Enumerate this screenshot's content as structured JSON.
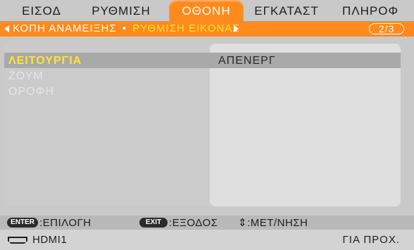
{
  "tabs": [
    {
      "label": "ΕΙΣΟΔ"
    },
    {
      "label": "ΡΥΘΜΙΣΗ"
    },
    {
      "label": "ΟΘΟΝΗ"
    },
    {
      "label": "ΕΓΚΑΤΑΣΤ"
    },
    {
      "label": "ΠΛΗΡΟΦ"
    }
  ],
  "active_tab": "ΟΘΟΝΗ",
  "subbar": {
    "previous": "ΚΟΠΗ ΑΝΑΜΕΙΞΗΣ",
    "separator": "•",
    "current": "ΡΥΘΜΙΣΗ ΕΙΚΟΝΑΣ",
    "page": "2/3"
  },
  "menu": {
    "items": [
      {
        "label": "ΛΕΙΤΟΥΡΓΙΑ",
        "value": "ΑΠΕΝΕΡΓ",
        "state": "selected"
      },
      {
        "label": "ΖΟΥΜ",
        "state": "disabled"
      },
      {
        "label": "ΟΡΟΦΗ",
        "state": "disabled"
      }
    ]
  },
  "help": {
    "enter_key": "ENTER",
    "enter_text": ":ΕΠΙΛΟΓΗ",
    "exit_key": "EXIT",
    "exit_text": ":ΕΞΟΔΟΣ",
    "move_text": "⇕:ΜΕΤ/ΝΗΣΗ"
  },
  "status": {
    "icon": "hdmi-icon",
    "source": "HDMI1",
    "right_text": "ΓΙΑ ΠΡΟΧ."
  },
  "colors": {
    "accent": "#ff8a1e",
    "highlight_text": "#ffe433",
    "background": "#c9c9c9"
  }
}
